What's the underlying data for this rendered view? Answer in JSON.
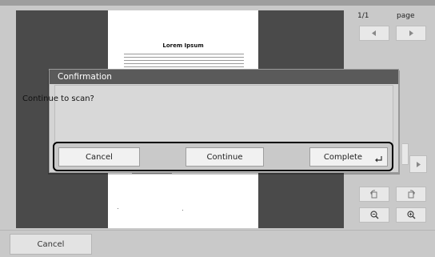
{
  "preview": {
    "document_title": "Lorem Ipsum"
  },
  "side_panel": {
    "page_counter": "1/1",
    "page_label": "page",
    "icons": {
      "prev_page": "left-triangle-icon",
      "next_page": "right-triangle-icon",
      "rotate_left": "rotate-left-icon",
      "rotate_right": "rotate-right-icon",
      "zoom_out": "zoom-out-icon",
      "zoom_in": "zoom-in-icon"
    }
  },
  "dialog": {
    "title": "Confirmation",
    "message": "Continue to scan?",
    "buttons": {
      "cancel": "Cancel",
      "continue": "Continue",
      "complete": "Complete"
    }
  },
  "bottom_bar": {
    "cancel_label": "Cancel"
  },
  "colors": {
    "dialog_header": "#5a5a5a",
    "preview_background": "#4a4a4a",
    "panel_background": "#c9c9c9",
    "button_background": "#f1f1f1"
  }
}
